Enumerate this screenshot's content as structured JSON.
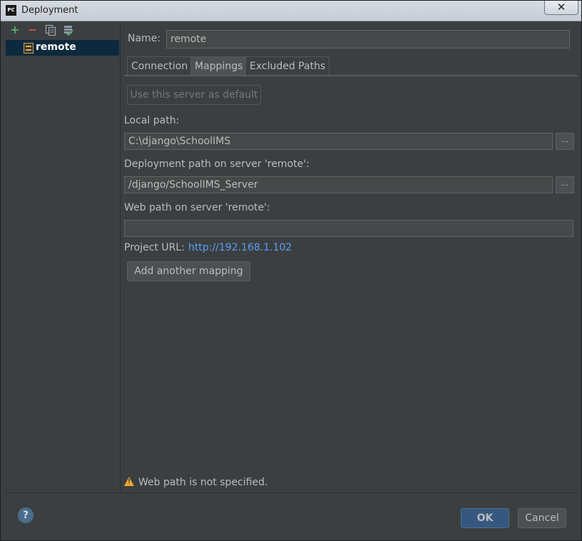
{
  "window": {
    "title": "Deployment",
    "app_icon": "PC",
    "close_glyph": "✕"
  },
  "toolbar": {
    "icons": [
      "plus-icon",
      "minus-icon",
      "copy-icon",
      "default-server-icon"
    ]
  },
  "servers": [
    {
      "label": "remote",
      "icon": "server-icon",
      "selected": true
    }
  ],
  "form": {
    "name_label": "Name:",
    "name_value": "remote",
    "tabs": [
      {
        "label": "Connection",
        "active": false
      },
      {
        "label": "Mappings",
        "active": true
      },
      {
        "label": "Excluded Paths",
        "active": false
      }
    ],
    "default_button": "Use this server as default",
    "local_path_label": "Local path:",
    "local_path_value": "C:\\django\\SchoolIMS",
    "deployment_path_label": "Deployment path on server 'remote':",
    "deployment_path_value": "/django/SchoolIMS_Server",
    "web_path_label": "Web path on server 'remote':",
    "web_path_value": "",
    "browse_glyph": "...",
    "project_url_label": "Project URL:",
    "project_url_value": "http://192.168.1.102",
    "add_mapping_button": "Add another mapping"
  },
  "warning": {
    "icon": "warning-icon",
    "text": "Web path is not specified."
  },
  "footer": {
    "help_glyph": "?",
    "ok_label": "OK",
    "cancel_label": "Cancel"
  },
  "colors": {
    "background": "#3c3f41",
    "selection": "#0d293e",
    "link": "#589df6",
    "warning": "#f0a732",
    "default_button": "#365880"
  }
}
